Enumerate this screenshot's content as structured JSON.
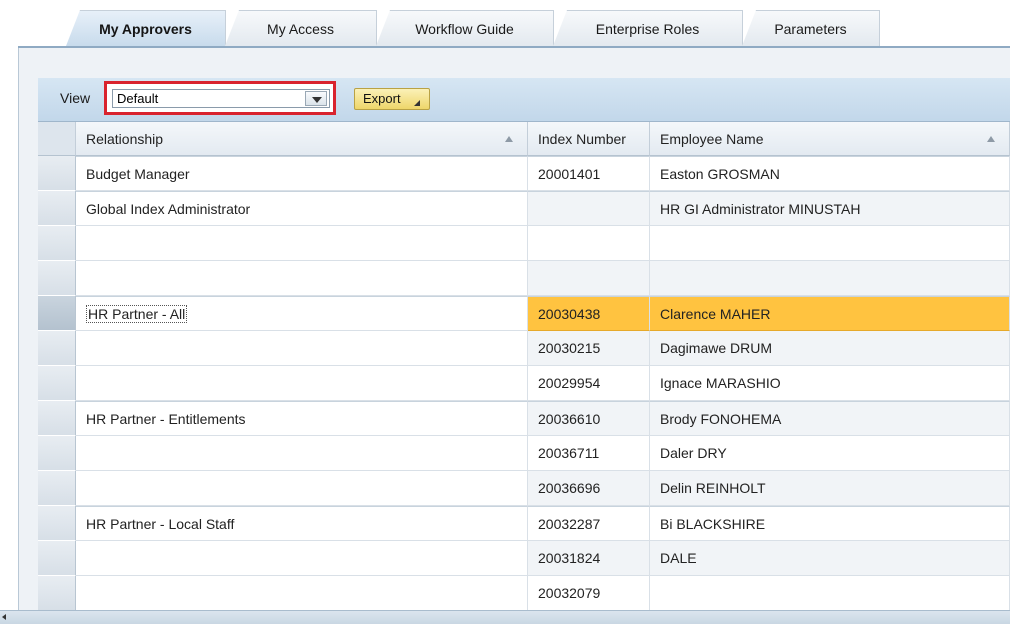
{
  "tabs": [
    {
      "label": "My Approvers",
      "active": true
    },
    {
      "label": "My Access",
      "active": false
    },
    {
      "label": "Workflow Guide",
      "active": false
    },
    {
      "label": "Enterprise Roles",
      "active": false
    },
    {
      "label": "Parameters",
      "active": false
    }
  ],
  "toolbar": {
    "view_label": "View",
    "view_value": "Default",
    "export_label": "Export"
  },
  "table": {
    "columns": {
      "relationship": "Relationship",
      "index_number": "Index Number",
      "employee_name": "Employee Name"
    },
    "rows": [
      {
        "relationship": "Budget Manager",
        "index": "20001401",
        "name": "Easton GROSMAN"
      },
      {
        "relationship": "Global Index Administrator",
        "index": "",
        "name": "HR GI Administrator MINUSTAH"
      },
      {
        "relationship": "",
        "index": "",
        "name": ""
      },
      {
        "relationship": "",
        "index": "",
        "name": ""
      },
      {
        "relationship": "HR Partner - All",
        "index": "20030438",
        "name": "Clarence MAHER",
        "selected": true
      },
      {
        "relationship": "",
        "index": "20030215",
        "name": "Dagimawe DRUM"
      },
      {
        "relationship": "",
        "index": "20029954",
        "name": "Ignace MARASHIO"
      },
      {
        "relationship": "HR Partner - Entitlements",
        "index": "20036610",
        "name": "Brody FONOHEMA"
      },
      {
        "relationship": "",
        "index": "20036711",
        "name": "Daler DRY"
      },
      {
        "relationship": "",
        "index": "20036696",
        "name": "Delin REINHOLT"
      },
      {
        "relationship": "HR Partner - Local Staff",
        "index": "20032287",
        "name": "Bi BLACKSHIRE"
      },
      {
        "relationship": "",
        "index": "20031824",
        "name": "DALE"
      },
      {
        "relationship": "",
        "index": "20032079",
        "name": ""
      }
    ]
  },
  "colors": {
    "highlight_border": "#d9232e",
    "selected_row": "#ffc340",
    "toolbar_bg": "#c8dbec"
  }
}
